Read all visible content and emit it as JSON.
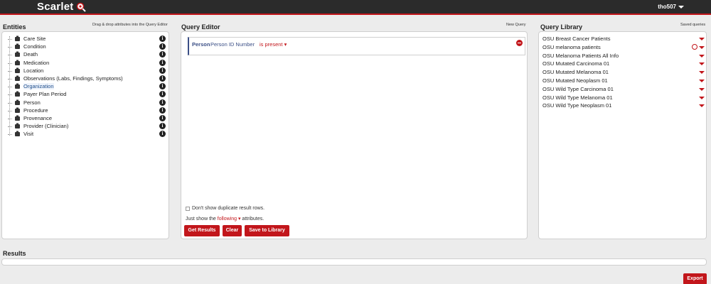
{
  "app": {
    "title": "Scarlet",
    "user": "tho507"
  },
  "entities": {
    "title": "Entities",
    "hint": "Drag & drop attributes into the Query Editor",
    "items": [
      {
        "label": "Care Site",
        "icon": "hospital-icon"
      },
      {
        "label": "Condition",
        "icon": "condition-icon"
      },
      {
        "label": "Death",
        "icon": "death-icon"
      },
      {
        "label": "Medication",
        "icon": "medication-icon"
      },
      {
        "label": "Location",
        "icon": "location-pin-icon"
      },
      {
        "label": "Observations (Labs, Findings, Symptoms)",
        "icon": "observation-icon"
      },
      {
        "label": "Organization",
        "icon": "organization-icon",
        "highlighted": true
      },
      {
        "label": "Payer Plan Period",
        "icon": "payer-icon"
      },
      {
        "label": "Person",
        "icon": "person-icon"
      },
      {
        "label": "Procedure",
        "icon": "procedure-icon"
      },
      {
        "label": "Provenance",
        "icon": "folder-icon"
      },
      {
        "label": "Provider (Clinician)",
        "icon": "stethoscope-icon"
      },
      {
        "label": "Visit",
        "icon": "calendar-icon"
      }
    ]
  },
  "query_editor": {
    "title": "Query Editor",
    "hint": "New Query",
    "criterion": {
      "entity": "Person",
      "attribute": "Person ID Number",
      "operator": "is present ▾"
    },
    "duplicate_label": "Don't show duplicate result rows.",
    "show_prefix": "Just show the",
    "show_link": "following ▾",
    "show_suffix": "attributes.",
    "buttons": {
      "get_results": "Get Results",
      "clear": "Clear",
      "save": "Save to Library"
    }
  },
  "library": {
    "title": "Query Library",
    "hint": "Saved queries",
    "items": [
      "OSU Breast Cancer Patients",
      "OSU melanoma patients",
      "OSU Melanoma Patients All Info",
      "OSU Mutated Carcinoma 01",
      "OSU Mutated Melanoma 01",
      "OSU Mutated Neoplasm 01",
      "OSU Wild Type Carcinoma 01",
      "OSU Wild Type Melanoma 01",
      "OSU Wild Type Neoplasm 01"
    ]
  },
  "results": {
    "title": "Results",
    "export_label": "Export"
  },
  "colors": {
    "accent": "#c2161b",
    "topbar": "#2b2b2b",
    "link_blue": "#3b4f86"
  }
}
